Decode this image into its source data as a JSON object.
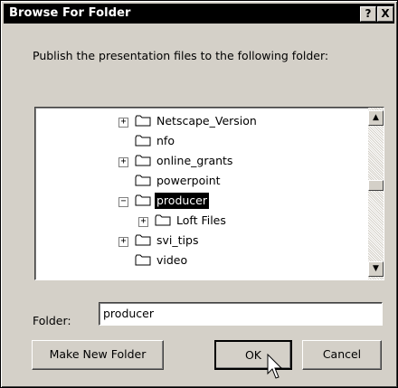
{
  "dialog": {
    "title": "Browse For Folder",
    "help_glyph": "?",
    "close_glyph": "X",
    "prompt": "Publish the presentation files to the following folder:"
  },
  "tree": {
    "items": [
      {
        "label": "Netscape_Version",
        "expander": "+"
      },
      {
        "label": "nfo",
        "expander": ""
      },
      {
        "label": "online_grants",
        "expander": "+"
      },
      {
        "label": "powerpoint",
        "expander": ""
      },
      {
        "label": "producer",
        "expander": "−",
        "selected": true
      },
      {
        "label": "Loft Files",
        "expander": "+"
      },
      {
        "label": "svi_tips",
        "expander": "+"
      },
      {
        "label": "video",
        "expander": ""
      }
    ]
  },
  "scrollbar": {
    "up_glyph": "▲",
    "down_glyph": "▼"
  },
  "folder_field": {
    "label": "Folder:",
    "value": "producer"
  },
  "buttons": {
    "make_new_folder": "Make New Folder",
    "ok": "OK",
    "cancel": "Cancel"
  },
  "colors": {
    "selection": "#000000",
    "dialog_bg": "#d4d0c8"
  }
}
